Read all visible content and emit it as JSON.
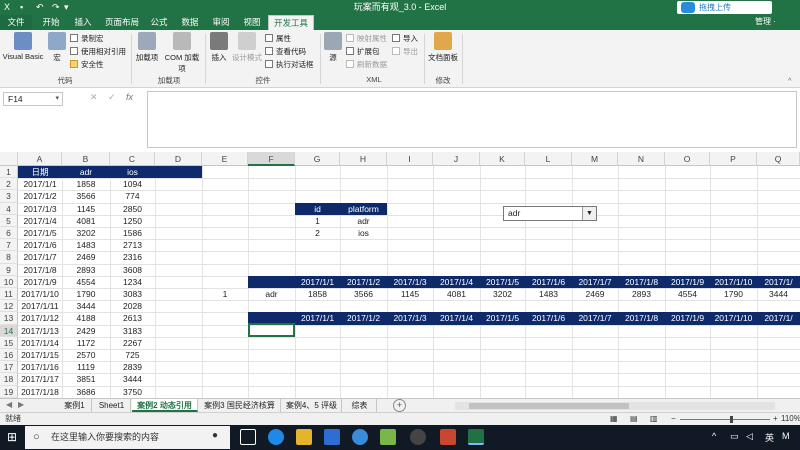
{
  "titlebar": {
    "document_title": "玩案而有观_3.0 - Excel",
    "upload_button": "拖拽上传",
    "win_minimize": "—",
    "win_maximize": "▢",
    "win_close": "✕"
  },
  "tabs": {
    "file": "文件",
    "items": [
      "开始",
      "插入",
      "页面布局",
      "公式",
      "数据",
      "审阅",
      "视图",
      "开发工具"
    ],
    "active": "开发工具",
    "user": "管理 ·"
  },
  "ribbon": {
    "groups": {
      "code": "代码",
      "addins": "加载项",
      "controls": "控件",
      "xml": "XML",
      "modify": "修改"
    },
    "code": {
      "visual_basic": "Visual Basic",
      "macros": "宏",
      "record_macro": "录制宏",
      "relative_ref": "使用相对引用",
      "macro_security": "安全性"
    },
    "addins": {
      "addins_btn": "加载项",
      "com_addins": "COM 加载项"
    },
    "controls": {
      "insert": "插入",
      "design_mode": "设计模式",
      "properties": "属性",
      "view_code": "查看代码",
      "run_dialog": "执行对话框"
    },
    "xml": {
      "source": "源",
      "map_properties": "映射属性",
      "expansion_packs": "扩展包",
      "refresh_data": "刷新数据",
      "import": "导入",
      "export": "导出"
    },
    "modify": {
      "doc_panel": "文档面板"
    }
  },
  "formula_bar": {
    "name_box": "F14",
    "cancel": "✕",
    "enter": "✓",
    "fx": "fx",
    "value": ""
  },
  "columns": [
    "A",
    "B",
    "C",
    "D",
    "E",
    "F",
    "G",
    "H",
    "I",
    "J",
    "K",
    "L",
    "M",
    "N",
    "O",
    "P",
    "Q"
  ],
  "selected_column": "F",
  "rows": [
    "1",
    "2",
    "3",
    "4",
    "5",
    "6",
    "7",
    "8",
    "9",
    "10",
    "11",
    "12",
    "13",
    "14",
    "15",
    "16",
    "17",
    "18",
    "19"
  ],
  "selected_row": "14",
  "data_table": {
    "headers": [
      "日期",
      "adr",
      "ios"
    ],
    "rows": [
      [
        "2017/1/1",
        "1858",
        "1094"
      ],
      [
        "2017/1/2",
        "3566",
        "774"
      ],
      [
        "2017/1/3",
        "1145",
        "2850"
      ],
      [
        "2017/1/4",
        "4081",
        "1250"
      ],
      [
        "2017/1/5",
        "3202",
        "1586"
      ],
      [
        "2017/1/6",
        "1483",
        "2713"
      ],
      [
        "2017/1/7",
        "2469",
        "2316"
      ],
      [
        "2017/1/8",
        "2893",
        "3608"
      ],
      [
        "2017/1/9",
        "4554",
        "1234"
      ],
      [
        "2017/1/10",
        "1790",
        "3083"
      ],
      [
        "2017/1/11",
        "3444",
        "2028"
      ],
      [
        "2017/1/12",
        "4188",
        "2613"
      ],
      [
        "2017/1/13",
        "2429",
        "3183"
      ],
      [
        "2017/1/14",
        "1172",
        "2267"
      ],
      [
        "2017/1/15",
        "2570",
        "725"
      ],
      [
        "2017/1/16",
        "1119",
        "2839"
      ],
      [
        "2017/1/17",
        "3851",
        "3444"
      ],
      [
        "2017/1/18",
        "3686",
        "3750"
      ]
    ]
  },
  "lookup_table": {
    "headers": [
      "id",
      "platform"
    ],
    "rows": [
      [
        "1",
        "adr"
      ],
      [
        "2",
        "ios"
      ]
    ]
  },
  "dropdown": {
    "value": "adr",
    "arrow": "▼"
  },
  "result": {
    "date_headers": [
      "2017/1/1",
      "2017/1/2",
      "2017/1/3",
      "2017/1/4",
      "2017/1/5",
      "2017/1/6",
      "2017/1/7",
      "2017/1/8",
      "2017/1/9",
      "2017/1/10",
      "2017/1/"
    ],
    "index": "1",
    "platform": "adr",
    "values": [
      "1858",
      "3566",
      "1145",
      "4081",
      "3202",
      "1483",
      "2469",
      "2893",
      "4554",
      "1790",
      "3444"
    ]
  },
  "sheet_tabs": {
    "items": [
      "案例1",
      "Sheet1",
      "案例2 动态引用",
      "案例3 国民经济核算",
      "案例4、5 评级",
      "综表"
    ],
    "active": "案例2 动态引用",
    "add": "+"
  },
  "statusbar": {
    "status": "就绪",
    "zoom": "110%",
    "zoom_out": "−",
    "zoom_in": "+"
  },
  "taskbar": {
    "search_placeholder": "在这里输入你要搜索的内容",
    "tray_lang": "英",
    "tray_caret": "^"
  }
}
